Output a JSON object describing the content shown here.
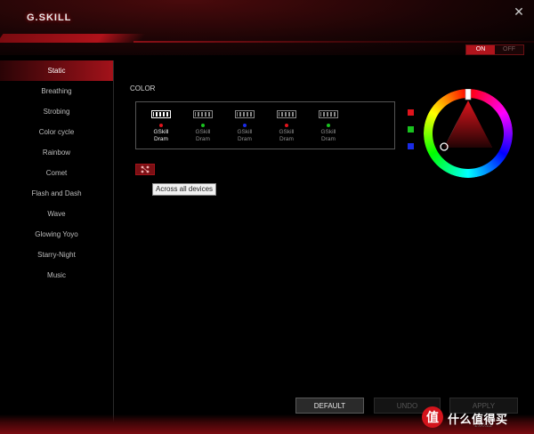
{
  "app": {
    "logo": "G.SKILL",
    "close": "✕"
  },
  "toggle": {
    "on": "ON",
    "off": "OFF"
  },
  "sidebar": {
    "items": [
      {
        "label": "Static",
        "active": true
      },
      {
        "label": "Breathing"
      },
      {
        "label": "Strobing"
      },
      {
        "label": "Color cycle"
      },
      {
        "label": "Rainbow"
      },
      {
        "label": "Comet"
      },
      {
        "label": "Flash and Dash"
      },
      {
        "label": "Wave"
      },
      {
        "label": "Glowing Yoyo"
      },
      {
        "label": "Starry-Night"
      },
      {
        "label": "Music"
      }
    ]
  },
  "main": {
    "color_label": "COLOR",
    "devices": [
      {
        "line1": "GSkill",
        "line2": "Dram",
        "dot_color": "#e0141c",
        "selected": true
      },
      {
        "line1": "GSkill",
        "line2": "Dram",
        "dot_color": "#19c21f"
      },
      {
        "line1": "GSkill",
        "line2": "Dram",
        "dot_color": "#1a2be6"
      },
      {
        "line1": "GSkill",
        "line2": "Dram",
        "dot_color": "#e0141c"
      },
      {
        "line1": "GSkill",
        "line2": "Dram",
        "dot_color": "#19c21f"
      }
    ],
    "sync_icon": "sync-devices-icon",
    "tooltip": "Across all devices",
    "swatches": [
      "#e0141c",
      "#19c21f",
      "#1a2be6"
    ]
  },
  "buttons": {
    "default": "DEFAULT",
    "undo": "UNDO",
    "apply": "APPLY"
  },
  "version": "1.00.22",
  "watermark": {
    "badge": "值",
    "text": "什么值得买"
  }
}
